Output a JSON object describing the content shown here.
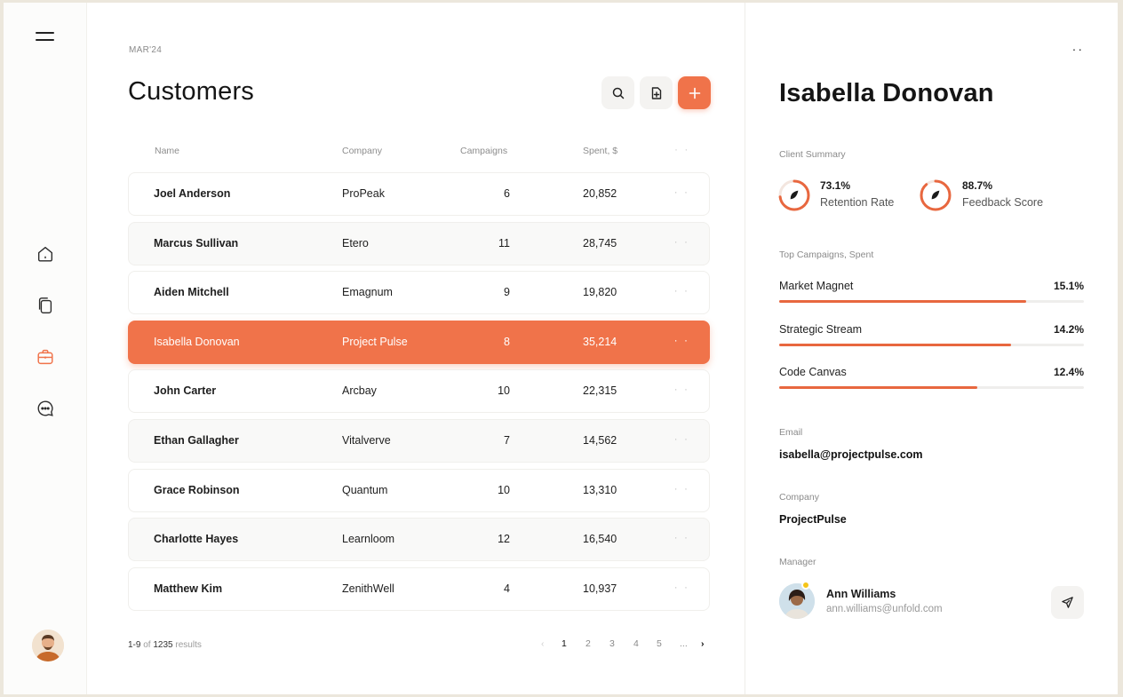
{
  "sidebar": {
    "nav": [
      {
        "icon": "home-icon"
      },
      {
        "icon": "copy-icon"
      },
      {
        "icon": "briefcase-icon",
        "active": true
      },
      {
        "icon": "chat-icon"
      }
    ],
    "accent": "#f0734a"
  },
  "header": {
    "date": "MAR'24",
    "title": "Customers"
  },
  "table": {
    "columns": [
      "Name",
      "Company",
      "Campaigns",
      "Spent, $"
    ],
    "more": "· ·",
    "rows": [
      {
        "name": "Joel Anderson",
        "company": "ProPeak",
        "campaigns": "6",
        "spent": "20,852"
      },
      {
        "name": "Marcus Sullivan",
        "company": "Etero",
        "campaigns": "11",
        "spent": "28,745"
      },
      {
        "name": "Aiden Mitchell",
        "company": "Emagnum",
        "campaigns": "9",
        "spent": "19,820"
      },
      {
        "name": "Isabella Donovan",
        "company": "Project Pulse",
        "campaigns": "8",
        "spent": "35,214"
      },
      {
        "name": "John Carter",
        "company": "Arcbay",
        "campaigns": "10",
        "spent": "22,315"
      },
      {
        "name": "Ethan Gallagher",
        "company": "Vitalverve",
        "campaigns": "7",
        "spent": "14,562"
      },
      {
        "name": "Grace Robinson",
        "company": "Quantum",
        "campaigns": "10",
        "spent": "13,310"
      },
      {
        "name": "Charlotte Hayes",
        "company": "Learnloom",
        "campaigns": "12",
        "spent": "16,540"
      },
      {
        "name": "Matthew Kim",
        "company": "ZenithWell",
        "campaigns": "4",
        "spent": "10,937"
      }
    ],
    "selected_row": 3
  },
  "pagination": {
    "range": "1-9",
    "of": "of",
    "total": "1235",
    "suffix": "results",
    "pages": [
      "1",
      "2",
      "3",
      "4",
      "5",
      "..."
    ],
    "current": "1"
  },
  "detail": {
    "name": "Isabella Donovan",
    "summary_label": "Client Summary",
    "metrics": [
      {
        "value": "73.1%",
        "label": "Retention Rate",
        "fraction": 0.731
      },
      {
        "value": "88.7%",
        "label": "Feedback Score",
        "fraction": 0.887
      }
    ],
    "campaigns_label": "Top Campaigns, Spent",
    "campaigns": [
      {
        "name": "Market Magnet",
        "pct": "15.1%",
        "fraction": 0.81
      },
      {
        "name": "Strategic Stream",
        "pct": "14.2%",
        "fraction": 0.76
      },
      {
        "name": "Code Canvas",
        "pct": "12.4%",
        "fraction": 0.65
      }
    ],
    "email_label": "Email",
    "email": "isabella@projectpulse.com",
    "company_label": "Company",
    "company": "ProjectPulse",
    "manager_label": "Manager",
    "manager_name": "Ann Williams",
    "manager_email": "ann.williams@unfold.com"
  }
}
